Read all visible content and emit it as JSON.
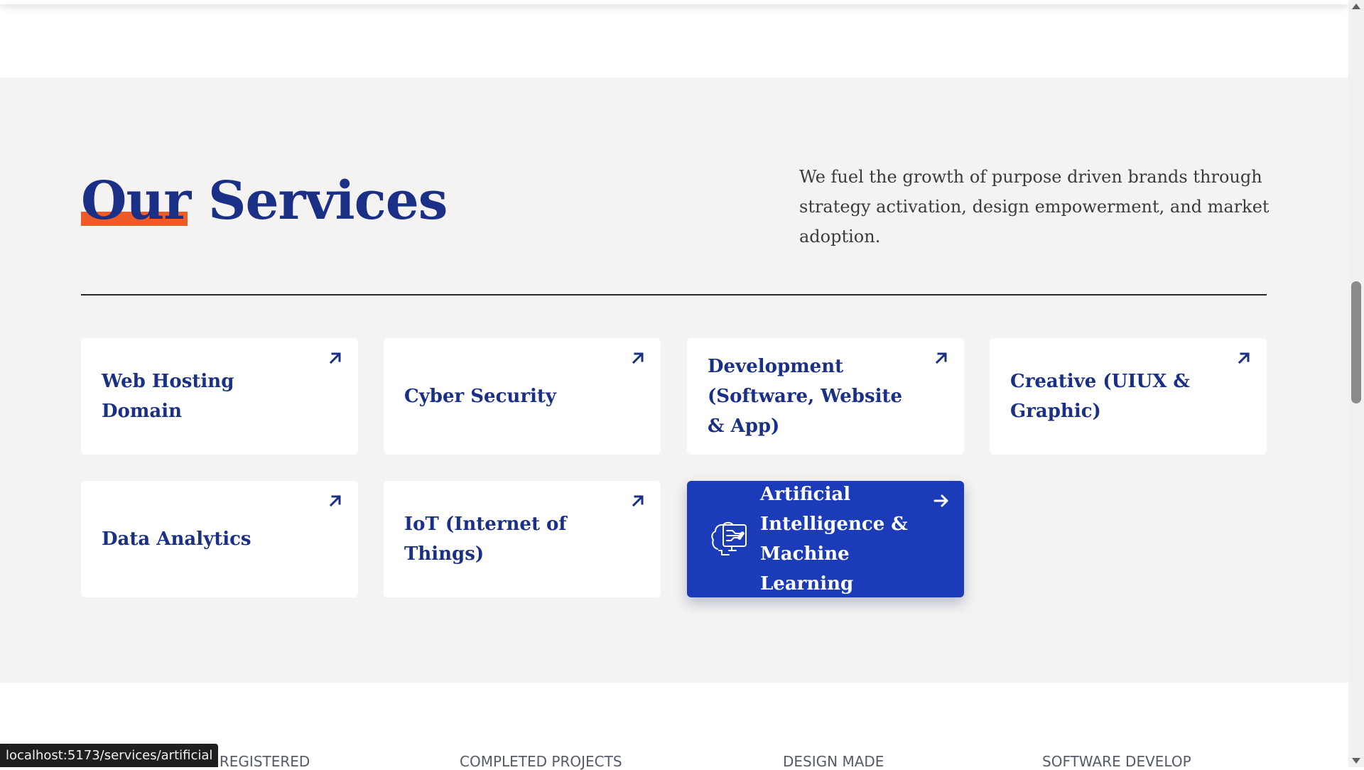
{
  "services_section": {
    "title": "Our Services",
    "intro": "We fuel the growth of purpose driven brands through strategy activation, design empowerment, and market adoption.",
    "cards": [
      {
        "label": "Web Hosting\nDomain",
        "icon": "arrow-up-right-icon",
        "active": false
      },
      {
        "label": "Cyber Security",
        "icon": "arrow-up-right-icon",
        "active": false
      },
      {
        "label": "Development\n(Software, Website\n& App)",
        "icon": "arrow-up-right-icon",
        "active": false
      },
      {
        "label": "Creative (UIUX &\nGraphic)",
        "icon": "arrow-up-right-icon",
        "active": false
      },
      {
        "label": "Data Analytics",
        "icon": "arrow-up-right-icon",
        "active": false
      },
      {
        "label": "IoT (Internet of\nThings)",
        "icon": "arrow-up-right-icon",
        "active": false
      },
      {
        "label": "Artificial\nIntelligence &\nMachine Learning",
        "icon": "arrow-right-icon",
        "leading_icon": "ai-brain-icon",
        "active": true
      }
    ]
  },
  "stats": [
    "AIN REGISTERED",
    "COMPLETED PROJECTS",
    "DESIGN MADE",
    "SOFTWARE DEVELOP"
  ],
  "status_bar": {
    "url": "localhost:5173/services/artificial"
  },
  "colors": {
    "brand_blue": "#1a2f86",
    "active_card": "#1b3bb8",
    "accent_orange": "#ee5b26",
    "section_bg": "#f4f3f1"
  }
}
